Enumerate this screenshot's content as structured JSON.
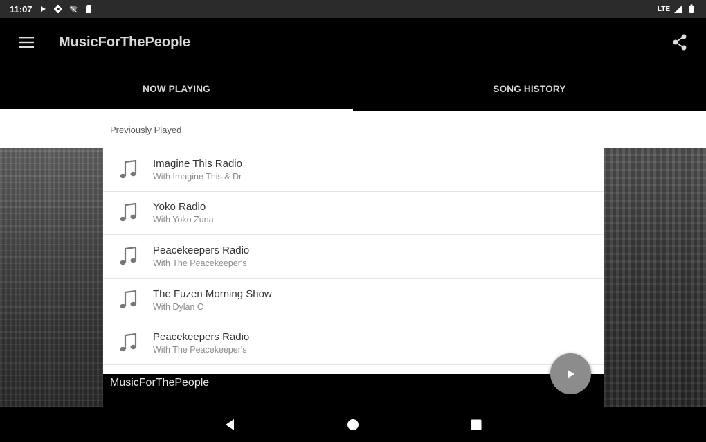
{
  "status_bar": {
    "time": "11:07",
    "network": "LTE",
    "icons": [
      "play-icon",
      "settings-icon",
      "wifi-off-icon",
      "sd-card-icon",
      "signal-icon",
      "battery-icon"
    ]
  },
  "app_bar": {
    "title": "MusicForThePeople",
    "menu_icon": "hamburger-menu-icon",
    "share_icon": "share-icon"
  },
  "tabs": [
    {
      "label": "NOW PLAYING",
      "active": true
    },
    {
      "label": "SONG HISTORY",
      "active": false
    }
  ],
  "history": {
    "header": "Previously Played",
    "items": [
      {
        "title": "Imagine This Radio",
        "subtitle": "With Imagine This & Dr"
      },
      {
        "title": "Yoko Radio",
        "subtitle": "With Yoko Zuna"
      },
      {
        "title": "Peacekeepers Radio",
        "subtitle": "With The Peacekeeper's"
      },
      {
        "title": "The Fuzen Morning Show",
        "subtitle": "With Dylan C"
      },
      {
        "title": "Peacekeepers Radio",
        "subtitle": "With The Peacekeeper's"
      }
    ]
  },
  "footer": {
    "station_name": "MusicForThePeople"
  },
  "fab": {
    "icon": "play-icon"
  },
  "colors": {
    "app_bar": "#000000",
    "tab_indicator": "#ffffff",
    "fab": "#8c8c8c"
  }
}
